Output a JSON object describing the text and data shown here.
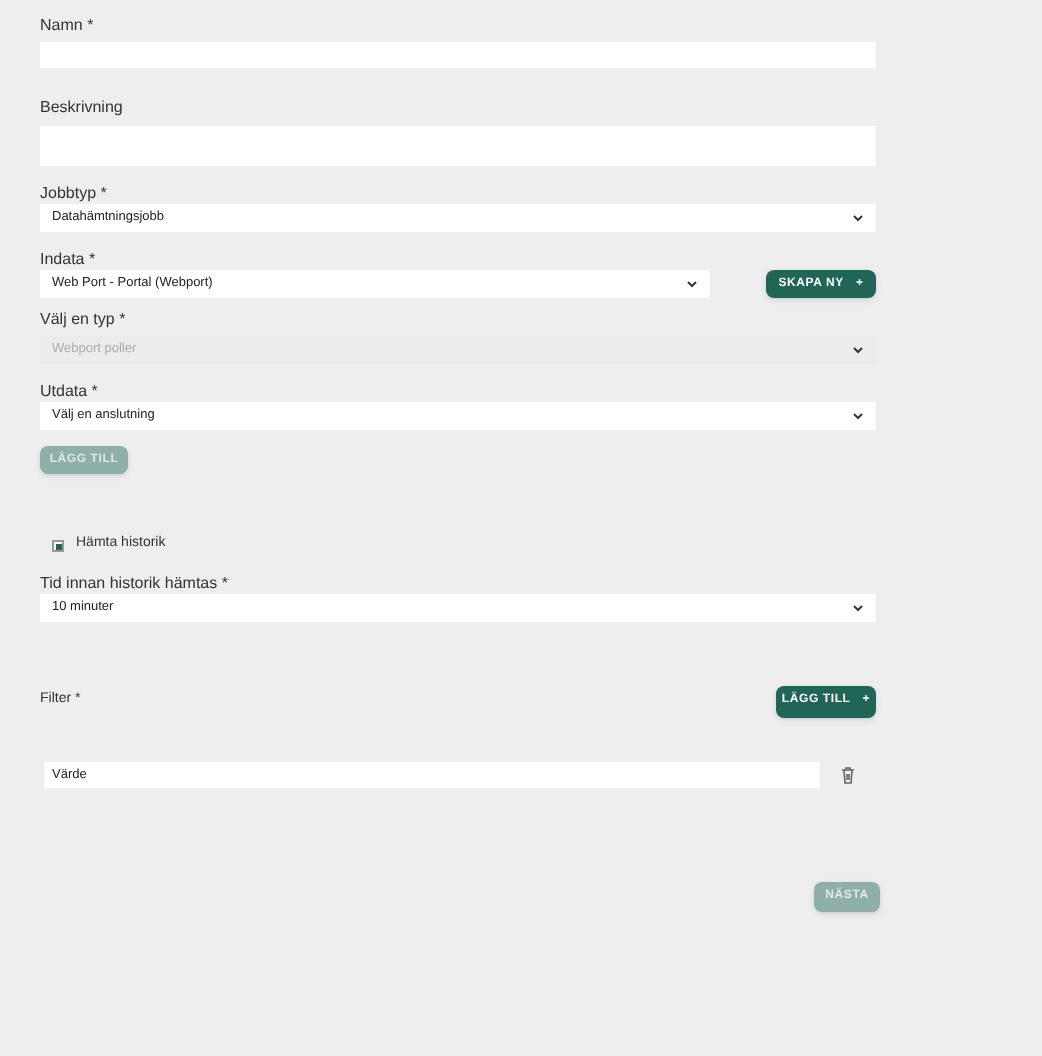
{
  "fields": [
    {
      "kind": "text",
      "label": "Namn *"
    },
    {
      "kind": "textarea",
      "label": "Beskrivning"
    },
    {
      "kind": "select",
      "label": "Jobbtyp *",
      "value": "Datahämtningsjobb",
      "disabled": false
    },
    {
      "kind": "select",
      "label": "Indata *",
      "value": "Web Port - Portal (Webport)",
      "disabled": false,
      "button": {
        "label": "SKAPA NY",
        "icon_text": "+",
        "disabled": false
      }
    },
    {
      "kind": "select",
      "label": "Välj en typ *",
      "value": "Webport poller",
      "disabled": true
    },
    {
      "kind": "select",
      "label": "Utdata *",
      "value": "Välj en anslutning",
      "disabled": false
    },
    {
      "kind": "button",
      "label": "LÄGG TILL",
      "disabled": true
    },
    {
      "kind": "checkbox",
      "label": "Hämta historik",
      "checked": true
    },
    {
      "kind": "select",
      "label": "Tid innan historik hämtas *",
      "value": "10 minuter",
      "disabled": false
    }
  ],
  "filter": {
    "label": "Filter *",
    "button": {
      "label": "LÄGG TILL",
      "icon_text": "+",
      "disabled": false
    },
    "rows": [
      {
        "value": "Värde"
      }
    ]
  },
  "next_button": {
    "label": "NÄSTA",
    "disabled": true
  }
}
